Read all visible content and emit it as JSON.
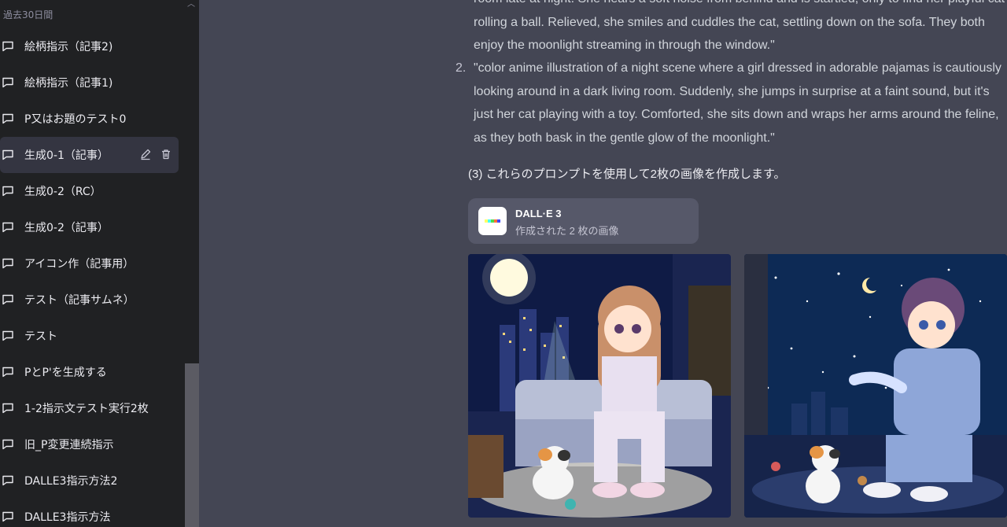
{
  "sidebar": {
    "section_label": "過去30日間",
    "items": [
      {
        "label": "絵柄指示（記事2)"
      },
      {
        "label": "絵柄指示（記事1)"
      },
      {
        "label": "P又はお題のテスト0"
      },
      {
        "label": "生成0-1（記事）",
        "active": true
      },
      {
        "label": "生成0-2（RC）"
      },
      {
        "label": "生成0-2（記事）"
      },
      {
        "label": "アイコン作（記事用）"
      },
      {
        "label": "テスト（記事サムネ）"
      },
      {
        "label": "テスト"
      },
      {
        "label": "PとP'を生成する"
      },
      {
        "label": "1-2指示文テスト実行2枚"
      },
      {
        "label": "旧_P変更連続指示"
      },
      {
        "label": "DALLE3指示方法2"
      },
      {
        "label": "DALLE3指示方法"
      }
    ]
  },
  "main": {
    "item1_tail": "room late at night. She hears a soft noise from behind and is startled, only to find her playful cat rolling a ball. Relieved, she smiles and cuddles the cat, settling down on the sofa. They both enjoy the moonlight streaming in through the window.\"",
    "item2_number": "2.",
    "item2_text": "\"color anime illustration of a night scene where a girl dressed in adorable pajamas is cautiously looking around in a dark living room. Suddenly, she jumps in surprise at a faint sound, but it's just her cat playing with a toy. Comforted, she sits down and wraps her arms around the feline, as they both bask in the gentle glow of the moonlight.\"",
    "step3": "(3) これらのプロンプトを使用して2枚の画像を作成します。",
    "dalle": {
      "title": "DALL·E 3",
      "subtitle": "作成された 2 枚の画像"
    }
  },
  "colors": {
    "sidebar_bg": "#202123",
    "active_item_bg": "#343541",
    "main_bg": "#444654",
    "card_bg": "#565869"
  }
}
